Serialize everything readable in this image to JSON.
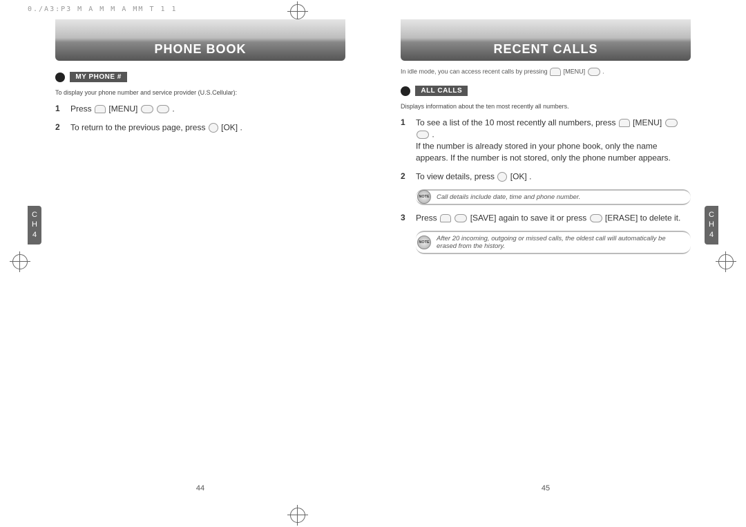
{
  "doc_header": "0./A3:P3  M  A   M      M    A MM         T 1 1",
  "left": {
    "header_title": "PHONE BOOK",
    "section_label": "MY PHONE #",
    "section_intro": "To display your phone number and service provider (U.S.Cellular):",
    "steps": [
      {
        "num": "1",
        "pre": "Press ",
        "menu": "[MENU]",
        "post": " ",
        "tail": "."
      },
      {
        "num": "2",
        "pre": "To return to the previous page, press ",
        "menu": "[OK]",
        "post": "",
        "tail": "."
      }
    ],
    "side_tab": "C\nH\n4",
    "page_number": "44"
  },
  "right": {
    "header_title": "RECENT CALLS",
    "idle_intro_pre": "In idle mode, you can access recent calls by pressing ",
    "idle_intro_menu": "[MENU]",
    "idle_intro_post": " .",
    "section_label": "ALL CALLS",
    "section_intro": "Displays information about the ten most recently all numbers.",
    "steps": [
      {
        "num": "1",
        "text_a": "To see a list of the 10 most recently all numbers, press ",
        "menu": "[MENU]",
        "text_b": " .",
        "text_c": "If the number is already stored in your phone book, only the name appears. If the number is not stored, only the phone number appears."
      },
      {
        "num": "2",
        "text_a": "To view details, press ",
        "menu": "[OK]",
        "text_b": ".",
        "text_c": ""
      },
      {
        "num": "3",
        "text_a": "Press ",
        "save": "[SAVE]",
        "text_b": " again to save it or press ",
        "erase": "[ERASE]",
        "text_c": " to delete it."
      }
    ],
    "note1": "Call details include date, time and phone number.",
    "note2": "After 20 incoming, outgoing or missed calls, the oldest call will automatically be erased from the history.",
    "note_icon_label": "NOTE",
    "side_tab": "C\nH\n4",
    "page_number": "45"
  }
}
